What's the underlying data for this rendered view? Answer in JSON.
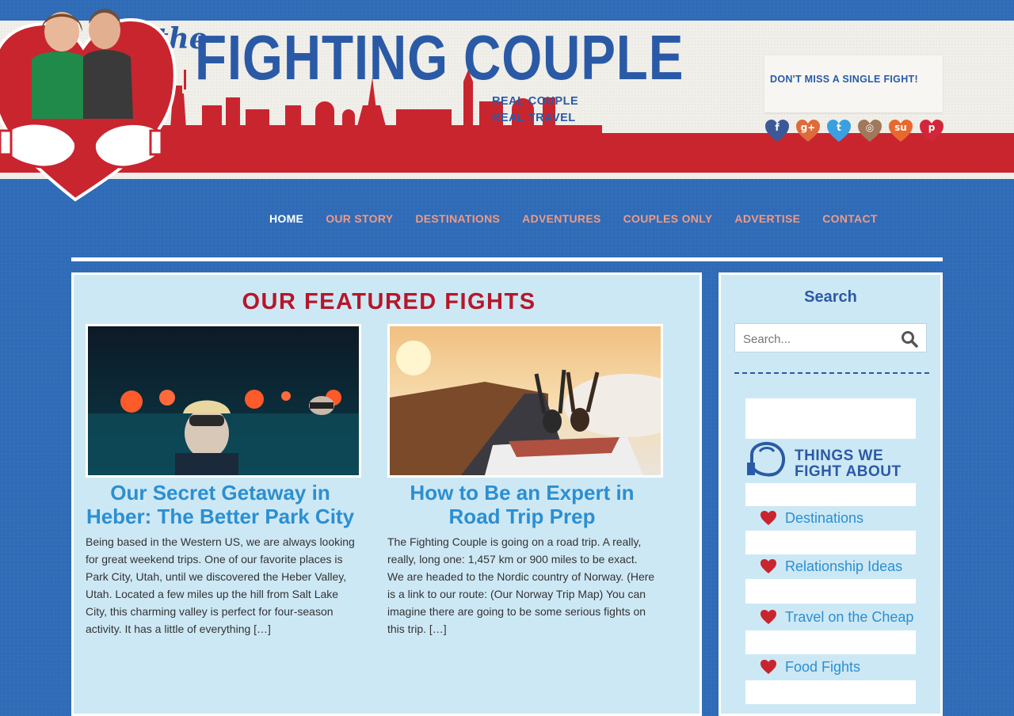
{
  "header": {
    "logo_the": "the",
    "logo_title": "FIGHTING COUPLE",
    "tagline_line1": "REAL COUPLE",
    "tagline_line2": "REAL TRAVEL",
    "dont_miss": "DON'T MISS A SINGLE FIGHT!",
    "social": [
      {
        "name": "facebook",
        "glyph": "f",
        "color": "#3b5998"
      },
      {
        "name": "google-plus",
        "glyph": "g+",
        "color": "#dd6b3c"
      },
      {
        "name": "twitter",
        "glyph": "t",
        "color": "#3aa0e0"
      },
      {
        "name": "instagram",
        "glyph": "◎",
        "color": "#a0785a"
      },
      {
        "name": "stumbleupon",
        "glyph": "su",
        "color": "#e8682e"
      },
      {
        "name": "pinterest",
        "glyph": "p",
        "color": "#d3263a"
      }
    ]
  },
  "nav": {
    "items": [
      "HOME",
      "OUR STORY",
      "DESTINATIONS",
      "ADVENTURES",
      "COUPLES ONLY",
      "ADVERTISE",
      "CONTACT"
    ]
  },
  "main": {
    "title": "OUR FEATURED FIGHTS",
    "posts": [
      {
        "title": "Our Secret Getaway in Heber: The Better Park City",
        "excerpt": "Being based in the Western US, we are always looking for great weekend trips. One of our favorite places is Park City, Utah, until we discovered the Heber Valley, Utah. Located a few miles up the hill from Salt Lake City, this charming valley is perfect for four-season activity. It has a little of everything […]"
      },
      {
        "title": "How to Be an Expert in Road Trip Prep",
        "excerpt": "The Fighting Couple is going on a road trip. A really, really, long one: 1,457 km or 900 miles to be exact. We are headed to the Nordic country of Norway. (Here is a link to our route: (Our Norway Trip Map) You can imagine there are going to be some serious fights on this trip. […]"
      }
    ]
  },
  "sidebar": {
    "search_title": "Search",
    "search_placeholder": "Search...",
    "things_heading_1": "THINGS WE",
    "things_heading_2": "FIGHT ABOUT",
    "categories": [
      "Destinations",
      "Relationship Ideas",
      "Travel on the Cheap",
      "Food Fights"
    ]
  },
  "colors": {
    "brand_blue": "#2a5aa6",
    "brand_red": "#c9252f",
    "link_blue": "#2b8fd1",
    "title_red": "#b5172a"
  }
}
